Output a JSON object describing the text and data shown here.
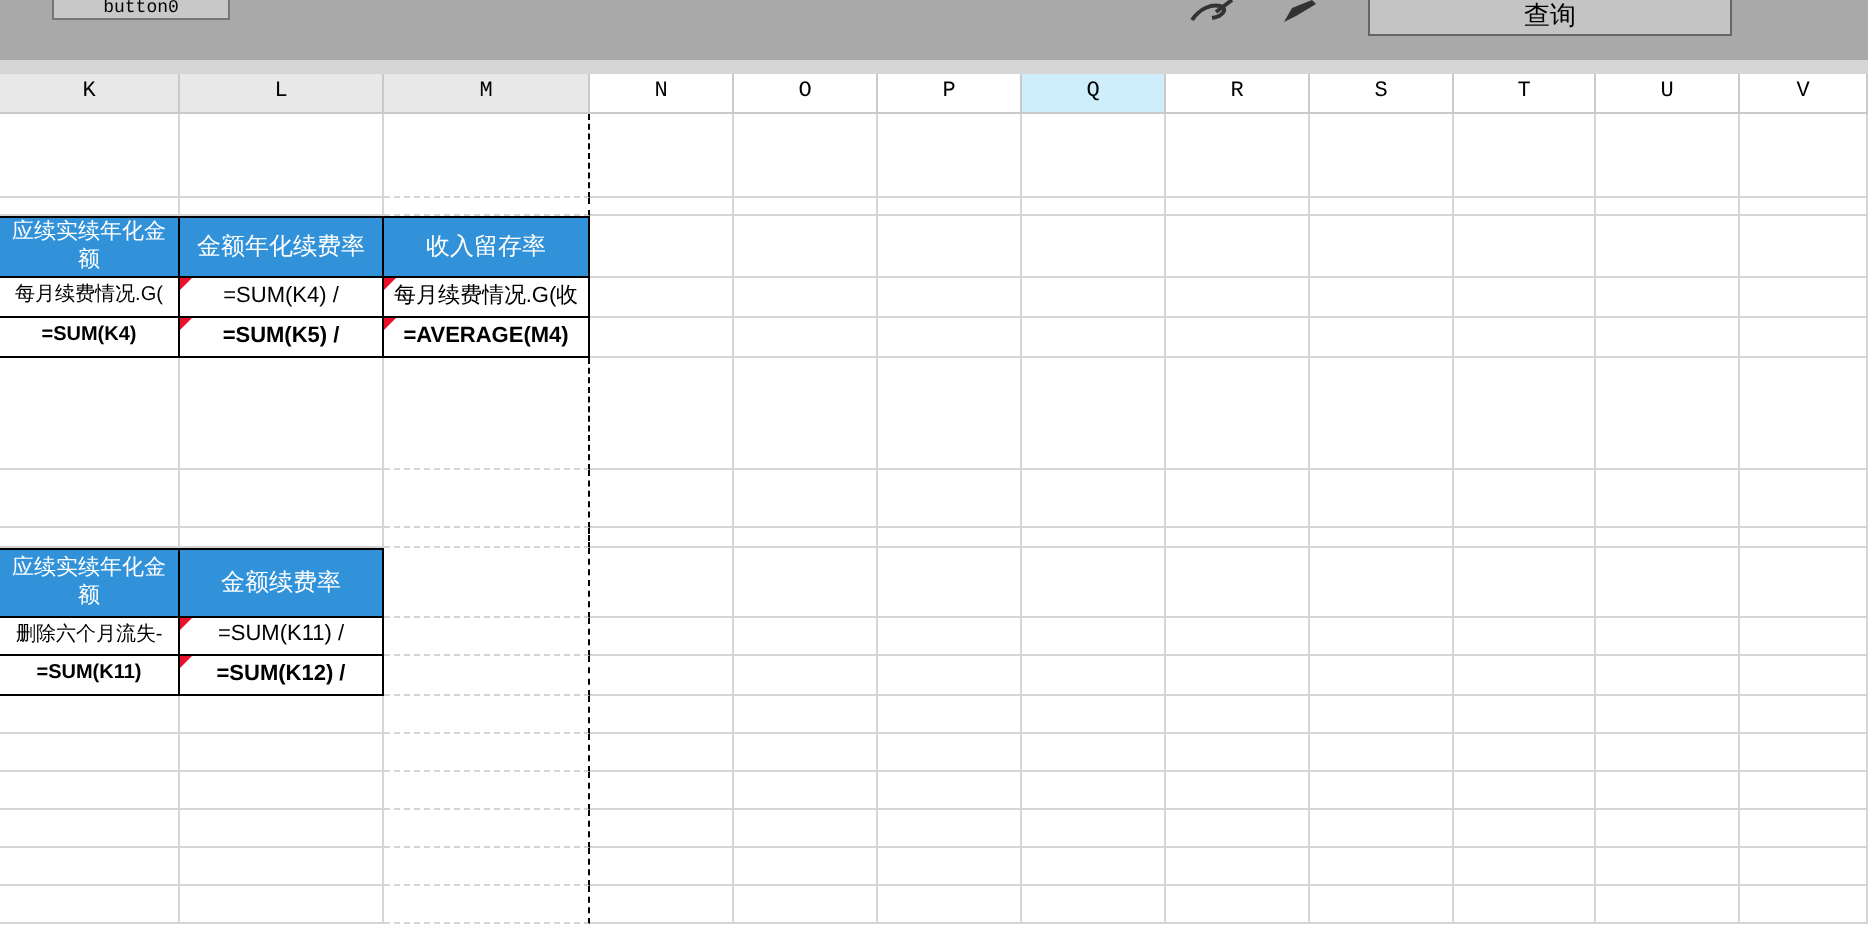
{
  "toolbar": {
    "buttons": [
      {
        "label": "button0"
      },
      {
        "label": "查询"
      }
    ]
  },
  "columns": [
    {
      "label": "K",
      "selected": false
    },
    {
      "label": "L",
      "selected": false
    },
    {
      "label": "M",
      "selected": false
    },
    {
      "label": "N",
      "selected": false
    },
    {
      "label": "O",
      "selected": false
    },
    {
      "label": "P",
      "selected": false
    },
    {
      "label": "Q",
      "selected": true
    },
    {
      "label": "R",
      "selected": false
    },
    {
      "label": "S",
      "selected": false
    },
    {
      "label": "T",
      "selected": false
    },
    {
      "label": "U",
      "selected": false
    },
    {
      "label": "V",
      "selected": false
    }
  ],
  "tables": [
    {
      "headers": [
        "应续实续年化金额",
        "金额年化续费率",
        "收入留存率"
      ],
      "rows": [
        [
          {
            "text": "每月续费情况.G(",
            "bold": false,
            "flagged": false
          },
          {
            "text": "=SUM(K4) /",
            "bold": false,
            "flagged": true
          },
          {
            "text": "每月续费情况.G(收",
            "bold": false,
            "flagged": true
          }
        ],
        [
          {
            "text": "=SUM(K4)",
            "bold": true,
            "flagged": false
          },
          {
            "text": "=SUM(K5) /",
            "bold": true,
            "flagged": true
          },
          {
            "text": "=AVERAGE(M4)",
            "bold": true,
            "flagged": true
          }
        ]
      ]
    },
    {
      "headers": [
        "应续实续年化金额",
        "金额续费率"
      ],
      "rows": [
        [
          {
            "text": "删除六个月流失-",
            "bold": false,
            "flagged": false
          },
          {
            "text": "=SUM(K11) /",
            "bold": false,
            "flagged": true
          }
        ],
        [
          {
            "text": "=SUM(K11)",
            "bold": true,
            "flagged": false
          },
          {
            "text": "=SUM(K12) /",
            "bold": true,
            "flagged": true
          }
        ]
      ]
    }
  ]
}
